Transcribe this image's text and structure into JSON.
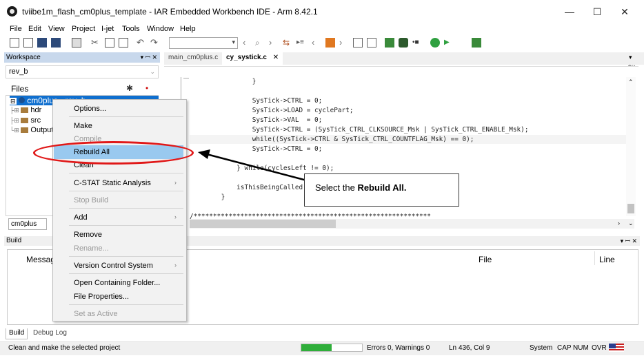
{
  "window": {
    "title": "tviibe1m_flash_cm0plus_template - IAR Embedded Workbench IDE - Arm 8.42.1",
    "minimize": "—",
    "maximize": "☐",
    "close": "✕"
  },
  "menu": [
    "File",
    "Edit",
    "View",
    "Project",
    "I-jet",
    "Tools",
    "Window",
    "Help"
  ],
  "workspace": {
    "header": "Workspace",
    "header_controls": "▾ ꟷ ✕",
    "config": "rev_b",
    "files_label": "Files",
    "project": "cm0plus - rev_b",
    "tree": [
      "hdr",
      "src",
      "Output"
    ],
    "tab": "cm0plus"
  },
  "editor": {
    "tabs": [
      {
        "label": "main_cm0plus.c",
        "active": false
      },
      {
        "label": "cy_systick.c",
        "active": true
      }
    ],
    "tab_close": "✕",
    "func_icon": "f()",
    "code_lines": [
      "            }",
      "",
      "            SysTick->CTRL = 0;",
      "            SysTick->LOAD = cyclePart;",
      "            SysTick->VAL  = 0;",
      "            SysTick->CTRL = (SysTick_CTRL_CLKSOURCE_Msk | SysTick_CTRL_ENABLE_Msk);",
      "            while((SysTick->CTRL & SysTick_CTRL_COUNTFLAG_Msk) == 0);",
      "            SysTick->CTRL = 0;",
      "",
      "        } while(cyclesLeft != 0);",
      "",
      "        isThisBeingCalled = false;",
      "    }",
      "",
      "/*************************************************************"
    ]
  },
  "context_menu": {
    "items": [
      {
        "label": "Options...",
        "enabled": true,
        "submenu": false
      },
      {
        "label": "Make",
        "enabled": true,
        "submenu": false
      },
      {
        "label": "Compile",
        "enabled": false,
        "submenu": false
      },
      {
        "label": "Rebuild All",
        "enabled": true,
        "submenu": false,
        "highlighted": true
      },
      {
        "label": "Clean",
        "enabled": true,
        "submenu": false
      },
      {
        "label": "C-STAT Static Analysis",
        "enabled": true,
        "submenu": true
      },
      {
        "label": "Stop Build",
        "enabled": false,
        "submenu": false
      },
      {
        "label": "Add",
        "enabled": true,
        "submenu": true
      },
      {
        "label": "Remove",
        "enabled": true,
        "submenu": false
      },
      {
        "label": "Rename...",
        "enabled": false,
        "submenu": false
      },
      {
        "label": "Version Control System",
        "enabled": true,
        "submenu": true
      },
      {
        "label": "Open Containing Folder...",
        "enabled": true,
        "submenu": false
      },
      {
        "label": "File Properties...",
        "enabled": true,
        "submenu": false
      },
      {
        "label": "Set as Active",
        "enabled": false,
        "submenu": false
      }
    ],
    "submenu_glyph": "›"
  },
  "callout": {
    "prefix": "Select the ",
    "bold": "Rebuild All."
  },
  "build": {
    "header": "Build",
    "header_controls": "▾ ꟷ ✕",
    "columns": [
      "Messages",
      "File",
      "Line"
    ],
    "tabs": [
      "Build",
      "Debug Log"
    ]
  },
  "status": {
    "message": "Clean and make the selected project",
    "progress_fraction": 0.5,
    "errors": "Errors 0, Warnings 0",
    "position": "Ln 436, Col 9",
    "indicators": [
      "System",
      "CAP",
      "NUM",
      "OVR"
    ]
  },
  "colors": {
    "selection": "#0f6fcf",
    "highlight": "#99c9ef",
    "annotation_red": "#e01818"
  }
}
